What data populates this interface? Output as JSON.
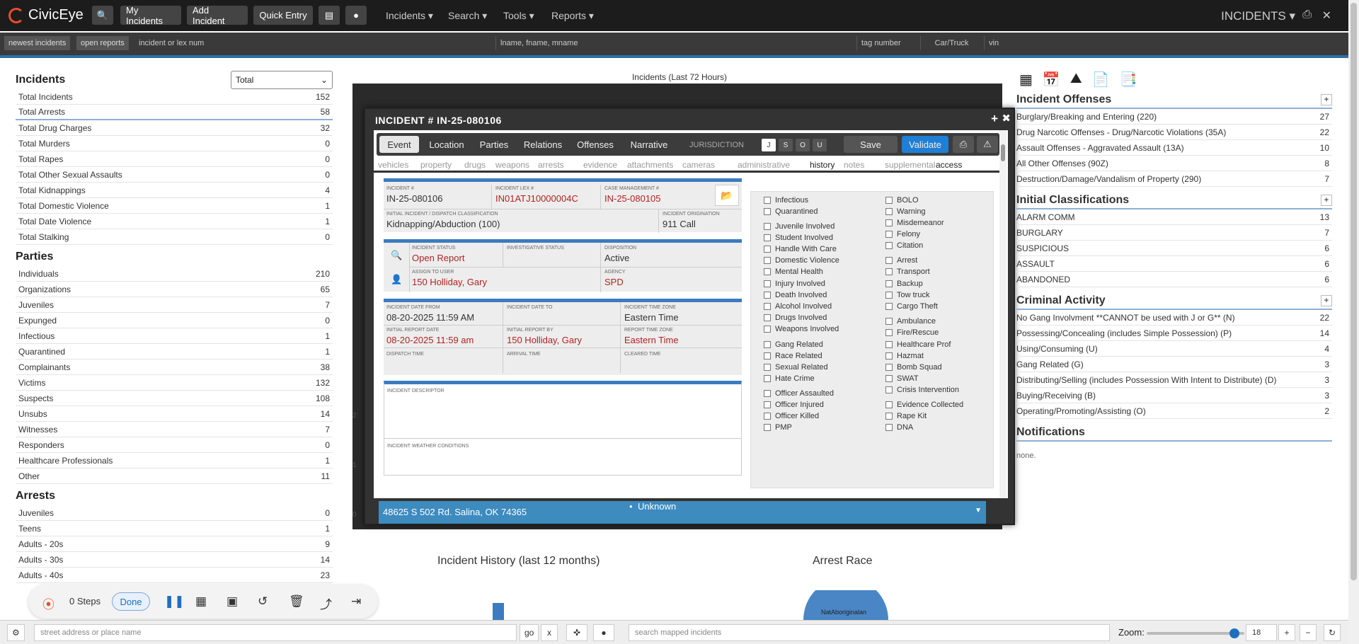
{
  "app": {
    "name": "CivicEye",
    "section": "INCIDENTS",
    "section_caret": "▾"
  },
  "topbar": {
    "my_incidents": "My Incidents",
    "add_incident": "Add Incident",
    "quick_entry": "Quick Entry",
    "menus": [
      {
        "label": "Incidents ▾"
      },
      {
        "label": "Search ▾"
      },
      {
        "label": "Tools ▾"
      },
      {
        "label": "Reports ▾"
      }
    ]
  },
  "searchbar": {
    "newest": "newest incidents",
    "open": "open reports",
    "incident_ph": "incident or lex num",
    "name_ph": "lname, fname, mname",
    "tag_ph": "tag number",
    "car_ph": "Car/Truck",
    "vin_ph": "vin"
  },
  "left": {
    "incidents_title": "Incidents",
    "select_value": "Total",
    "incidents": [
      {
        "label": "Total Incidents",
        "value": "152"
      },
      {
        "label": "Total Arrests",
        "value": "58"
      },
      {
        "label": "Total Drug Charges",
        "value": "32"
      },
      {
        "label": "Total Murders",
        "value": "0"
      },
      {
        "label": "Total Rapes",
        "value": "0"
      },
      {
        "label": "Total Other Sexual Assaults",
        "value": "0"
      },
      {
        "label": "Total Kidnappings",
        "value": "4"
      },
      {
        "label": "Total Domestic Violence",
        "value": "1"
      },
      {
        "label": "Total Date Violence",
        "value": "1"
      },
      {
        "label": "Total Stalking",
        "value": "0"
      }
    ],
    "parties_title": "Parties",
    "parties": [
      {
        "label": "Individuals",
        "value": "210"
      },
      {
        "label": "Organizations",
        "value": "65"
      },
      {
        "label": "Juveniles",
        "value": "7"
      },
      {
        "label": "Expunged",
        "value": "0"
      },
      {
        "label": "Infectious",
        "value": "1"
      },
      {
        "label": "Quarantined",
        "value": "1"
      },
      {
        "label": "Complainants",
        "value": "38"
      },
      {
        "label": "Victims",
        "value": "132"
      },
      {
        "label": "Suspects",
        "value": "108"
      },
      {
        "label": "Unsubs",
        "value": "14"
      },
      {
        "label": "Witnesses",
        "value": "7"
      },
      {
        "label": "Responders",
        "value": "0"
      },
      {
        "label": "Healthcare Professionals",
        "value": "1"
      },
      {
        "label": "Other",
        "value": "11"
      }
    ],
    "arrests_title": "Arrests",
    "arrests": [
      {
        "label": "Juveniles",
        "value": "0"
      },
      {
        "label": "Teens",
        "value": "1"
      },
      {
        "label": "Adults - 20s",
        "value": "9"
      },
      {
        "label": "Adults - 30s",
        "value": "14"
      },
      {
        "label": "Adults - 40s",
        "value": "23"
      }
    ]
  },
  "chart": {
    "title": "Incidents (Last 72 Hours)",
    "y2": "2",
    "y1": "1",
    "y0": "0"
  },
  "modal": {
    "title": "INCIDENT # IN-25-080106",
    "tabs": [
      "Event",
      "Location",
      "Parties",
      "Relations",
      "Offenses",
      "Narrative"
    ],
    "jurisdiction": "JURISDICTION",
    "jur": [
      "J",
      "S",
      "O",
      "U"
    ],
    "save": "Save",
    "validate": "Validate",
    "subtabs": [
      "vehicles",
      "property",
      "drugs",
      "weapons",
      "arrests",
      "evidence",
      "attachments",
      "cameras",
      "administrative",
      "history",
      "notes",
      "supplemental",
      "access"
    ],
    "labels": {
      "inc_num": "INCIDENT #",
      "lex": "INCIDENT LEX #",
      "case": "CASE MANAGEMENT #",
      "init_class": "INITIAL INCIDENT / DISPATCH CLASSIFICATION",
      "origination": "INCIDENT ORIGINATION",
      "status": "INCIDENT STATUS",
      "inv_status": "INVESTIGATIVE STATUS",
      "disposition": "DISPOSITION",
      "assign": "ASSIGN TO USER",
      "agency": "AGENCY",
      "date_from": "INCIDENT DATE FROM",
      "date_to": "INCIDENT DATE TO",
      "tz": "INCIDENT TIME ZONE",
      "rep_date": "INITIAL REPORT DATE",
      "rep_by": "INITIAL REPORT BY",
      "rep_tz": "REPORT TIME ZONE",
      "dispatch": "DISPATCH TIME",
      "arrival": "ARRIVAL TIME",
      "cleared": "CLEARED TIME",
      "descriptor": "INCIDENT DESCRIPTOR",
      "weather": "INCIDENT WEATHER CONDITIONS"
    },
    "values": {
      "inc_num": "IN-25-080106",
      "lex": "IN01ATJ10000004C",
      "case": "IN-25-080105",
      "init_class": "Kidnapping/Abduction (100)",
      "origination": "911 Call",
      "status": "Open Report",
      "disposition": "Active",
      "assign": "150 Holliday, Gary",
      "agency": "SPD",
      "date_from": "08-20-2025 11:59 AM",
      "tz": "Eastern Time",
      "rep_date": "08-20-2025 11:59 am",
      "rep_by": "150 Holliday, Gary",
      "rep_tz": "Eastern Time"
    },
    "checks_left": [
      "Infectious",
      "Quarantined",
      "Juvenile Involved",
      "Student Involved",
      "Handle With Care",
      "Domestic Violence",
      "Mental Health",
      "Injury Involved",
      "Death Involved",
      "Alcohol Involved",
      "Drugs Involved",
      "Weapons Involved",
      "Gang Related",
      "Race Related",
      "Sexual Related",
      "Hate Crime",
      "Officer Assaulted",
      "Officer Injured",
      "Officer Killed",
      "PMP"
    ],
    "checks_right": [
      "BOLO",
      "Warning",
      "Misdemeanor",
      "Felony",
      "Citation",
      "Arrest",
      "Transport",
      "Backup",
      "Tow truck",
      "Cargo Theft",
      "Ambulance",
      "Fire/Rescue",
      "Healthcare Prof",
      "Hazmat",
      "Bomb Squad",
      "SWAT",
      "Crisis Intervention",
      "Evidence Collected",
      "Rape Kit",
      "DNA"
    ],
    "address": "48625 S 502 Rd. Salina, OK 74365",
    "address_status": "Unknown"
  },
  "right": {
    "offenses_title": "Incident Offenses",
    "offenses": [
      {
        "label": "Burglary/Breaking and Entering (220)",
        "value": "27"
      },
      {
        "label": "Drug Narcotic Offenses - Drug/Narcotic Violations (35A)",
        "value": "22"
      },
      {
        "label": "Assault Offenses - Aggravated Assault (13A)",
        "value": "10"
      },
      {
        "label": "All Other Offenses (90Z)",
        "value": "8"
      },
      {
        "label": "Destruction/Damage/Vandalism of Property (290)",
        "value": "7"
      }
    ],
    "classifications_title": "Initial Classifications",
    "classifications": [
      {
        "label": "ALARM COMM",
        "value": "13"
      },
      {
        "label": "BURGLARY",
        "value": "7"
      },
      {
        "label": "SUSPICIOUS",
        "value": "6"
      },
      {
        "label": "ASSAULT",
        "value": "6"
      },
      {
        "label": "ABANDONED",
        "value": "6"
      }
    ],
    "criminal_title": "Criminal Activity",
    "criminal": [
      {
        "label": "No Gang Involvment **CANNOT be used with J or G** (N)",
        "value": "22"
      },
      {
        "label": "Possessing/Concealing (includes Simple Possession) (P)",
        "value": "14"
      },
      {
        "label": "Using/Consuming (U)",
        "value": "4"
      },
      {
        "label": "Gang Related (G)",
        "value": "3"
      },
      {
        "label": "Distributing/Selling (includes Possession With Intent to Distribute) (D)",
        "value": "3"
      },
      {
        "label": "Buying/Receiving (B)",
        "value": "3"
      },
      {
        "label": "Operating/Promoting/Assisting (O)",
        "value": "2"
      }
    ],
    "notifications_title": "Notifications",
    "notifications_text": "none."
  },
  "bottom_charts": {
    "history_title": "Incident History (last 12 months)",
    "race_title": "Arrest Race",
    "pie_label": "NatAboriginalan"
  },
  "recorder": {
    "steps": "0 Steps",
    "done": "Done"
  },
  "bottombar": {
    "street_ph": "street address or place name",
    "go": "go",
    "x": "x",
    "search_ph": "search mapped incidents",
    "zoom_label": "Zoom:",
    "zoom_value": "18",
    "zoom_level": 0.9
  },
  "colors": {
    "accent": "#2e6ea8",
    "brand": "#e8502b",
    "validate": "#1f7fd4"
  }
}
